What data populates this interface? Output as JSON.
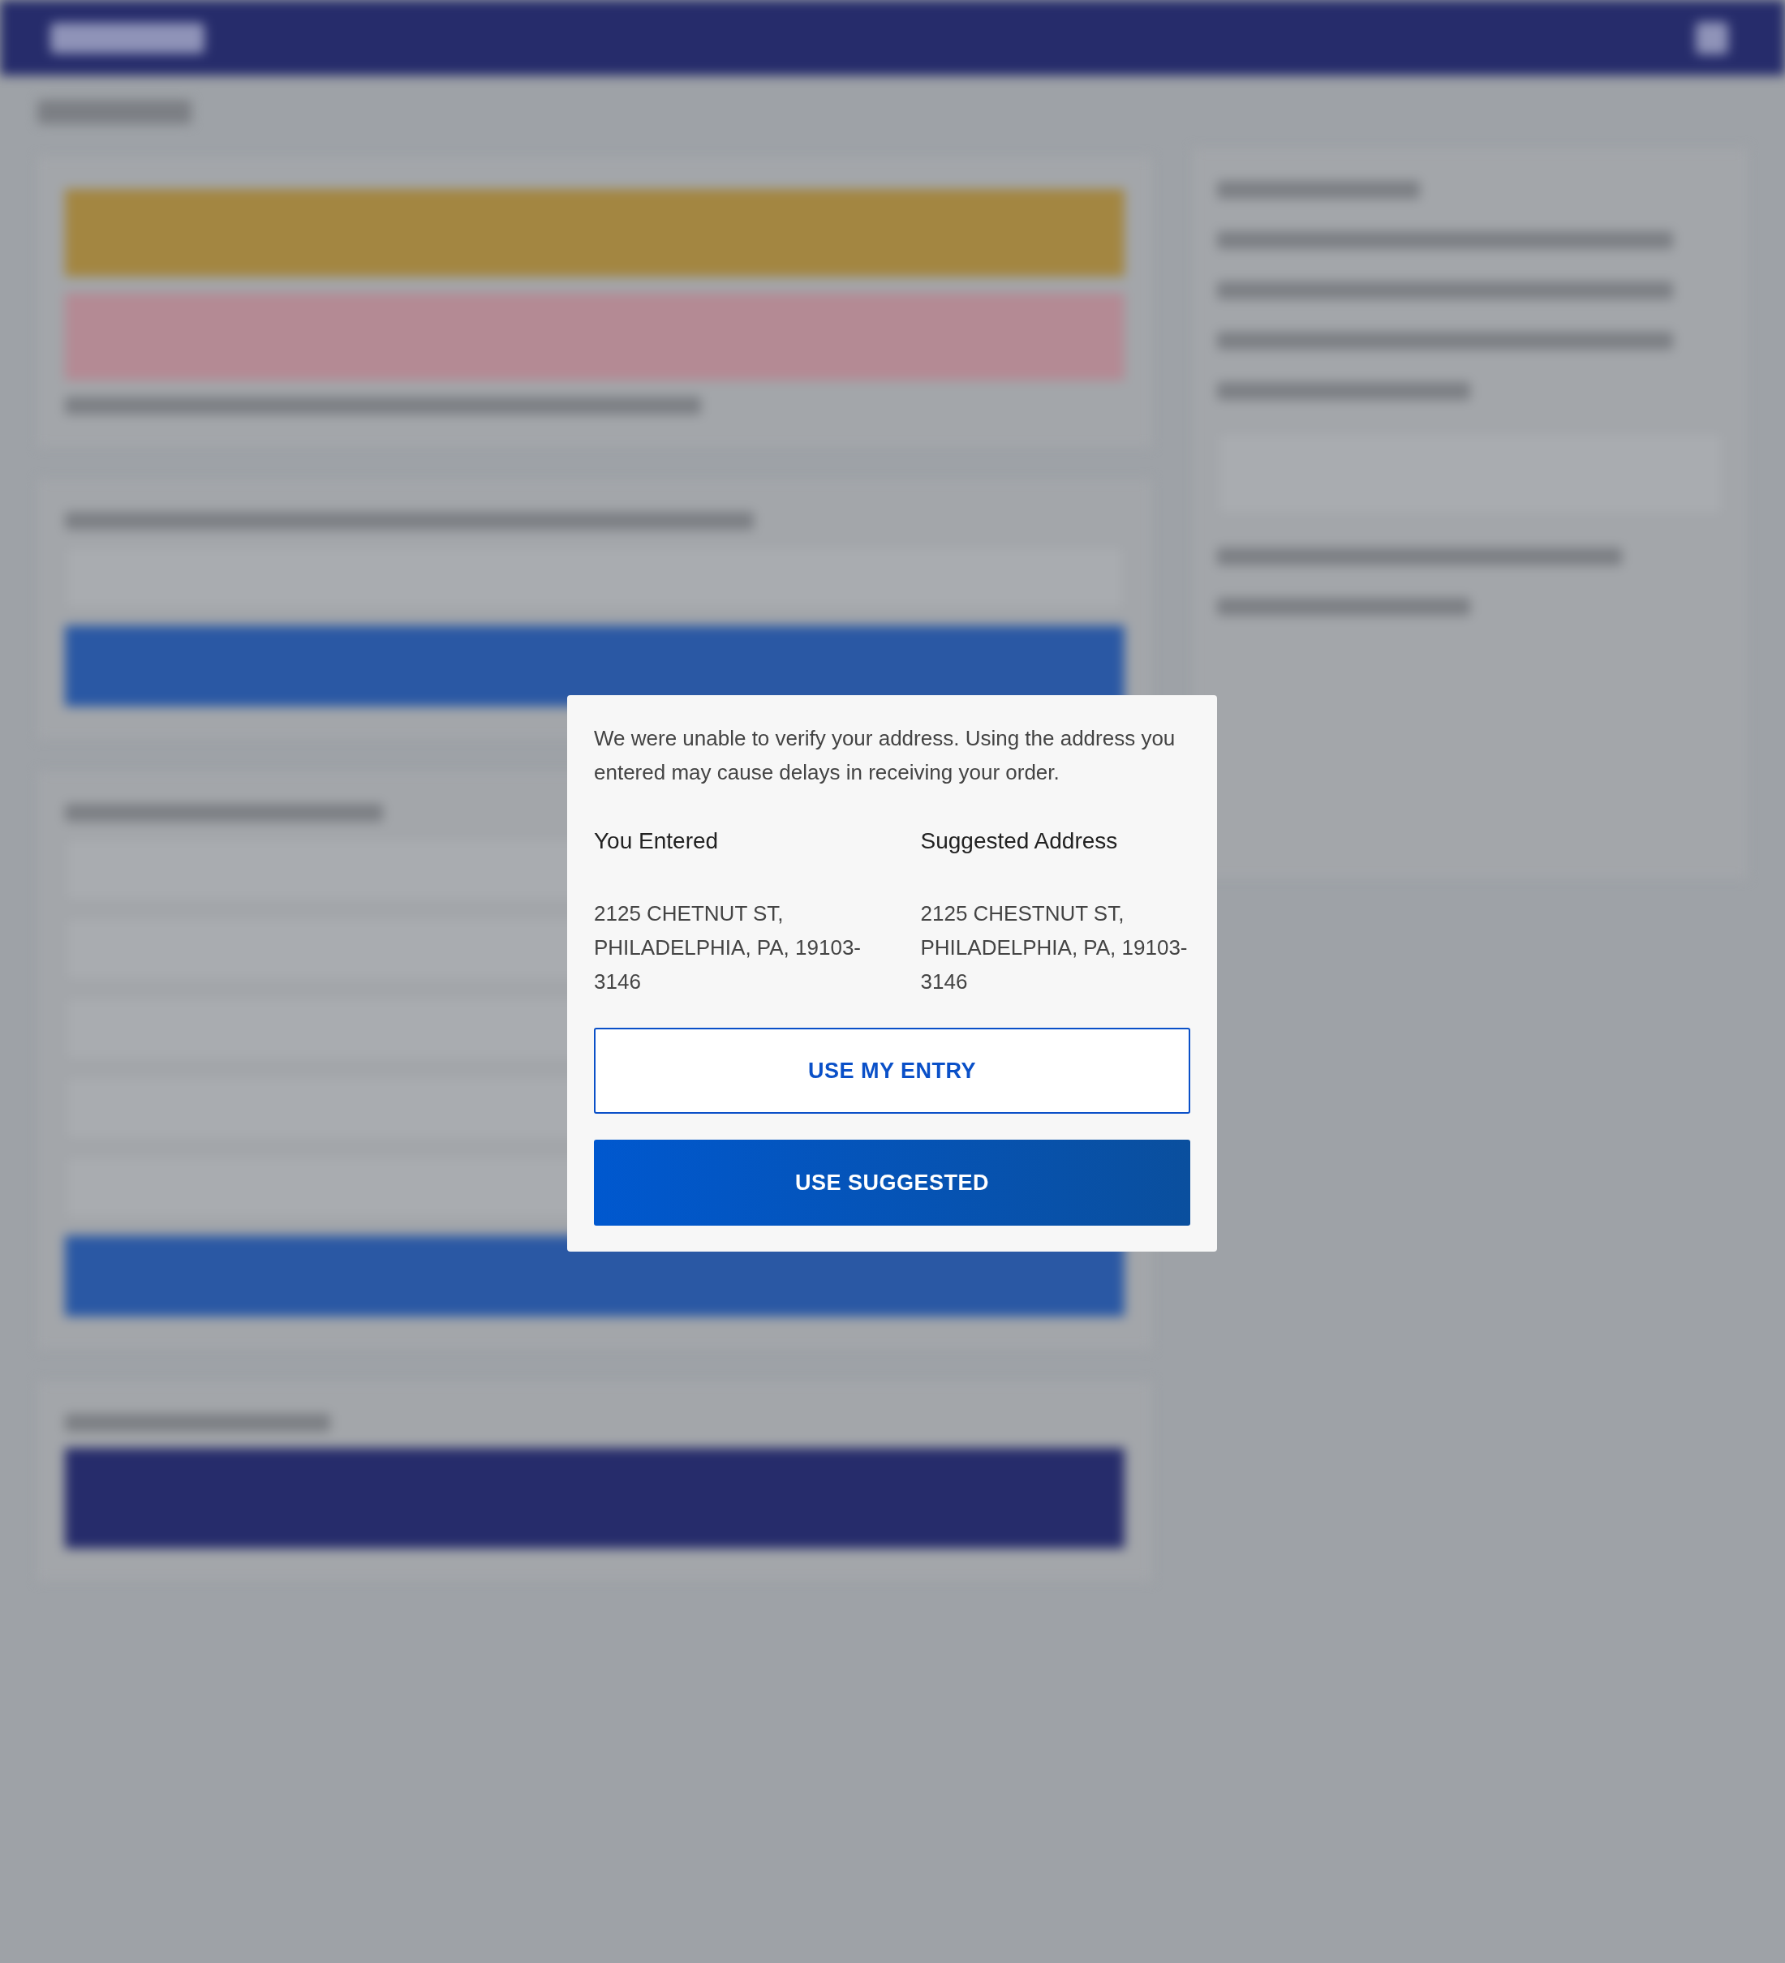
{
  "dialog": {
    "message": "We were unable to verify your address. Using the address you entered may cause delays in receiving your order.",
    "addresses": [
      {
        "heading": "You Entered",
        "text": "2125 CHETNUT ST, PHILADELPHIA, PA, 19103-3146"
      },
      {
        "heading": "Suggested Address",
        "text": "2125 CHESTNUT ST, PHILADELPHIA, PA, 19103-3146"
      }
    ],
    "buttons": [
      {
        "label": "USE MY ENTRY",
        "kind": "outline"
      },
      {
        "label": "USE SUGGESTED",
        "kind": "primary"
      }
    ]
  }
}
